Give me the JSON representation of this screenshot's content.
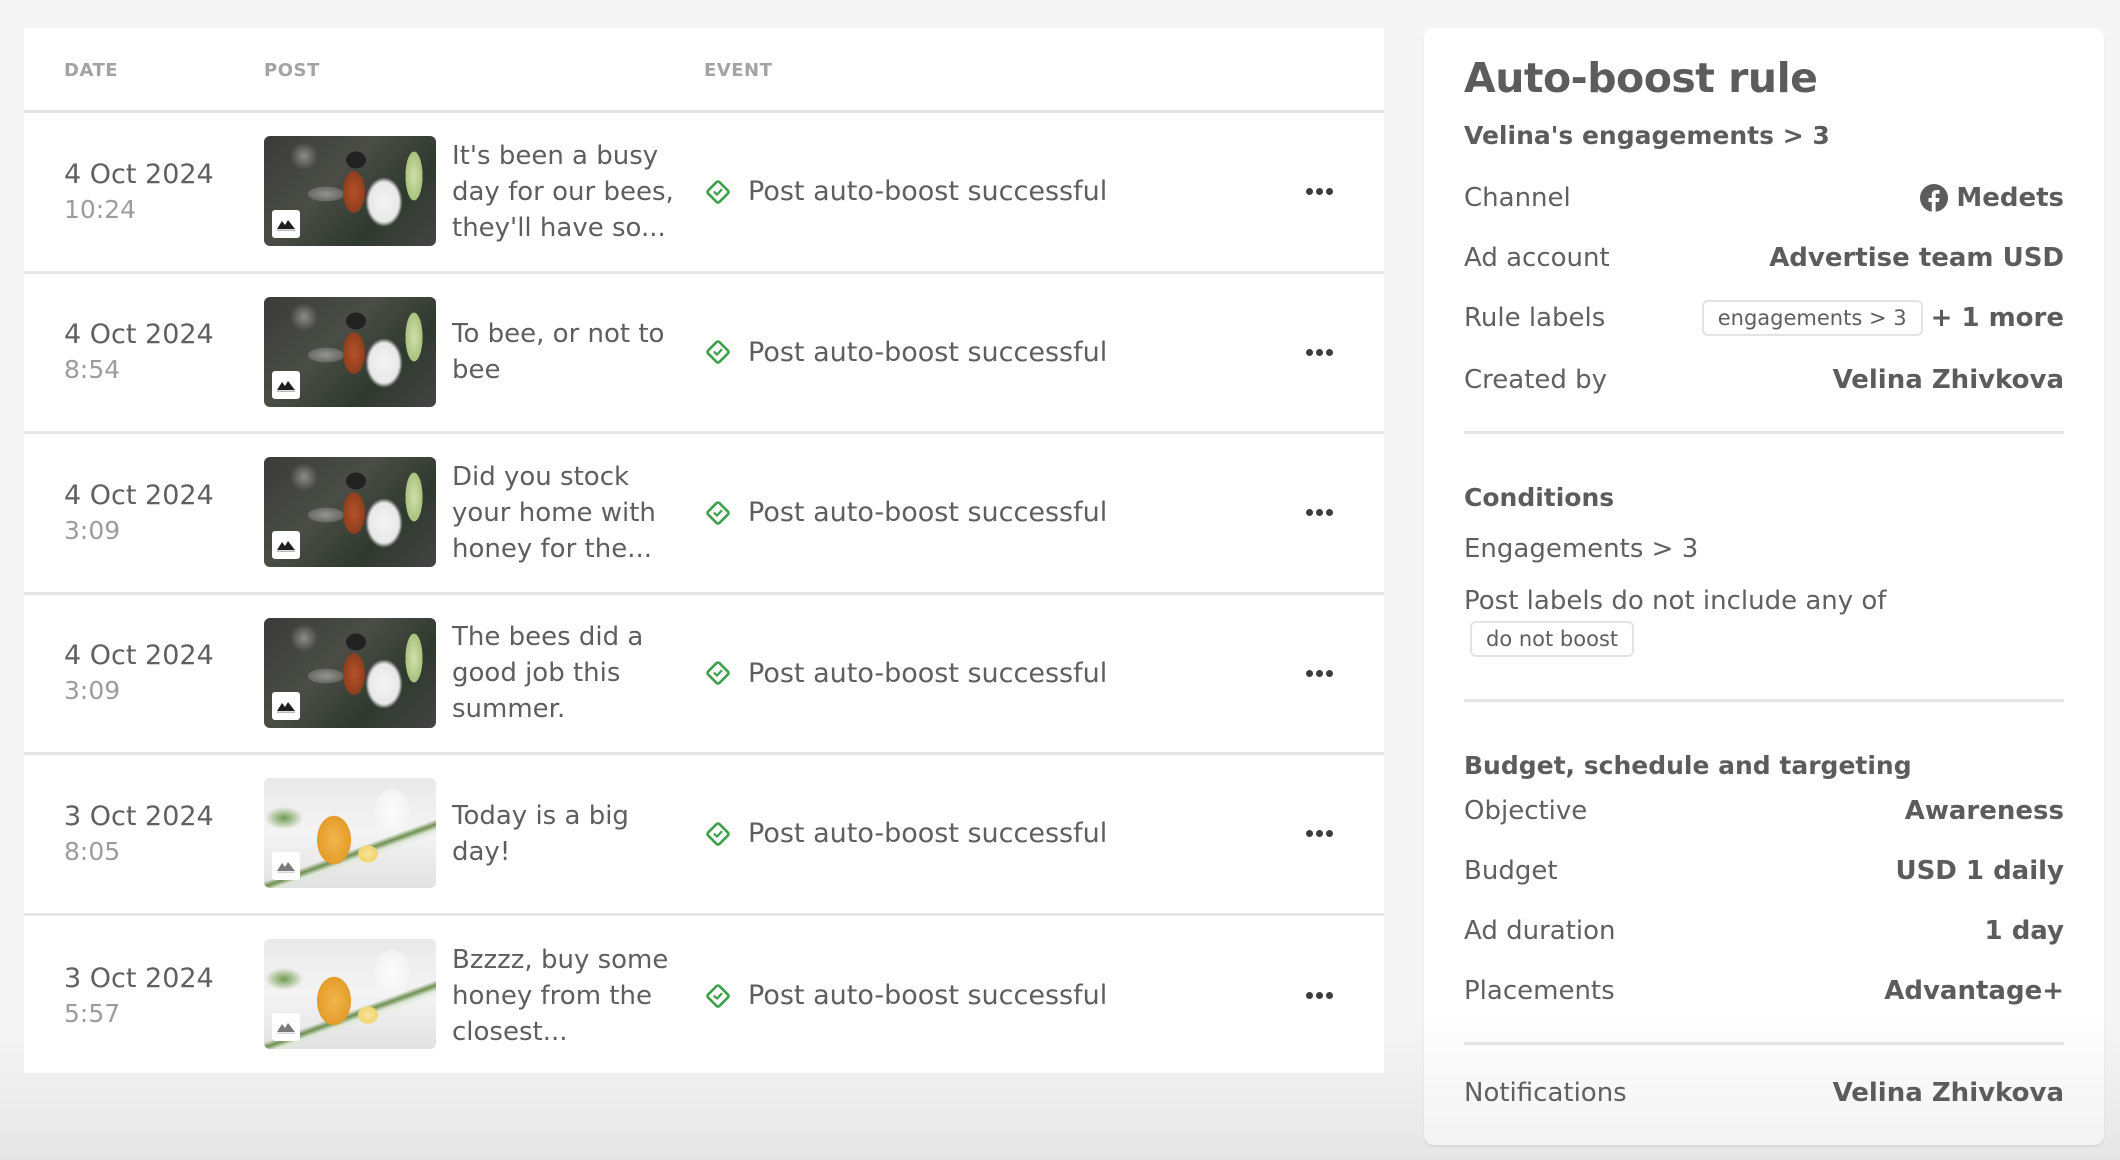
{
  "table": {
    "columns": {
      "date": "DATE",
      "post": "POST",
      "event": "EVENT"
    },
    "rows": [
      {
        "date": "4 Oct 2024",
        "time": "10:24",
        "post_text": "It's been a busy day for our bees, they'll have so...",
        "thumbnail": "bee-on-flower",
        "event": "Post auto-boost successful"
      },
      {
        "date": "4 Oct 2024",
        "time": "8:54",
        "post_text": "To bee, or not to bee",
        "thumbnail": "bee-on-flower",
        "event": "Post auto-boost successful"
      },
      {
        "date": "4 Oct 2024",
        "time": "3:09",
        "post_text": "Did you stock your home with honey for the...",
        "thumbnail": "bee-on-flower",
        "event": "Post auto-boost successful"
      },
      {
        "date": "4 Oct 2024",
        "time": "3:09",
        "post_text": "The bees did a good job this summer.",
        "thumbnail": "bee-on-flower",
        "event": "Post auto-boost successful"
      },
      {
        "date": "3 Oct 2024",
        "time": "8:05",
        "post_text": "Today is a big day!",
        "thumbnail": "honey-jar-and-tea",
        "event": "Post auto-boost successful"
      },
      {
        "date": "3 Oct 2024",
        "time": "5:57",
        "post_text": "Bzzzz, buy some honey from the closest...",
        "thumbnail": "honey-jar-and-tea",
        "event": "Post auto-boost successful"
      }
    ],
    "event_icon": "check-diamond-icon",
    "more_icon": "ellipsis-icon",
    "success_color": "#3da04a"
  },
  "panel": {
    "title": "Auto-boost rule",
    "rule_name": "Velina's engagements > 3",
    "details": {
      "channel_label": "Channel",
      "channel_value": "Medets",
      "channel_icon": "facebook-icon",
      "ad_account_label": "Ad account",
      "ad_account_value": "Advertise team USD",
      "rule_labels_label": "Rule labels",
      "rule_label_chip": "engagements > 3",
      "rule_labels_more": "+ 1 more",
      "created_by_label": "Created by",
      "created_by_value": "Velina Zhivkova"
    },
    "conditions": {
      "heading": "Conditions",
      "engagements": "Engagements > 3",
      "post_labels": "Post labels do not include any of",
      "excluded_label": "do not boost"
    },
    "budget": {
      "heading": "Budget, schedule and targeting",
      "objective_label": "Objective",
      "objective_value": "Awareness",
      "budget_label": "Budget",
      "budget_value": "USD 1 daily",
      "duration_label": "Ad duration",
      "duration_value": "1 day",
      "placements_label": "Placements",
      "placements_value": "Advantage+"
    },
    "notifications": {
      "label": "Notifications",
      "value": "Velina Zhivkova"
    }
  }
}
